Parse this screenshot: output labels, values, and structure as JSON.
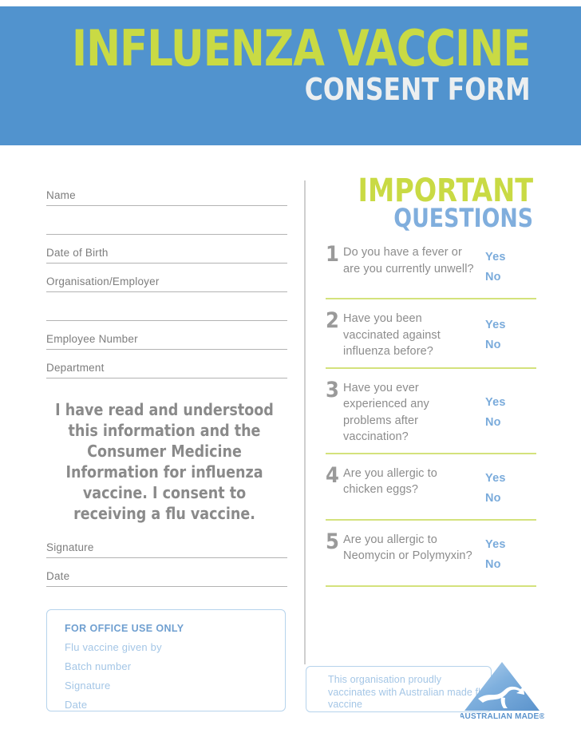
{
  "header": {
    "title_main": "INFLUENZA VACCINE",
    "title_sub": "CONSENT FORM",
    "bg_color": "#5193ce",
    "accent_green": "#c9da44",
    "title_sub_color": "#eceff0"
  },
  "left_column": {
    "fields": [
      {
        "label": "Name"
      },
      {
        "label": ""
      },
      {
        "label": "Date of Birth"
      },
      {
        "label": "Organisation/Employer"
      },
      {
        "label": ""
      },
      {
        "label": "Employee Number"
      },
      {
        "label": "Department"
      }
    ],
    "consent_text": "I have read and understood this information and the Consumer Medicine Information for influenza vaccine. I consent to receiving a flu vaccine.",
    "signature_fields": [
      {
        "label": "Signature"
      },
      {
        "label": "Date"
      }
    ],
    "office_box": {
      "title": "FOR OFFICE USE ONLY",
      "items": [
        "Flu vaccine given by",
        "Batch number",
        "Signature",
        "Date"
      ],
      "border_color": "#b6d3ec",
      "title_color": "#6f9fd0",
      "item_color": "#a4c6e6"
    }
  },
  "right_column": {
    "heading_line1": "IMPORTANT",
    "heading_line2": "QUESTIONS",
    "heading_line1_color": "#c9da44",
    "heading_line2_color": "#80aedd",
    "answer_yes": "Yes",
    "answer_no": "No",
    "answer_color": "#7aabdb",
    "separator_color": "#d4e27c",
    "questions": [
      {
        "number": "1",
        "text": "Do you have a fever or are you currently unwell?"
      },
      {
        "number": "2",
        "text": "Have you been vaccinated against influenza before?"
      },
      {
        "number": "3",
        "text": "Have you ever experienced any problems after vaccination?"
      },
      {
        "number": "4",
        "text": "Are you allergic to chicken eggs?"
      },
      {
        "number": "5",
        "text": "Are you allergic to Neomycin or Polymyxin?"
      }
    ]
  },
  "footer": {
    "australian_made_text": "This organisation proudly vaccinates with Australian made flu vaccine",
    "logo_caption": "AUSTRALIAN MADE",
    "logo_registered_mark": "®",
    "logo_color": "#6fa8dc"
  }
}
